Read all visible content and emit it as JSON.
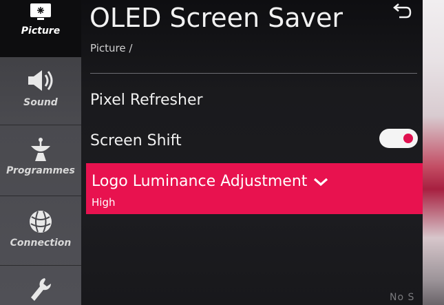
{
  "header": {
    "title": "OLED Screen Saver",
    "breadcrumb": "Picture /"
  },
  "sidebar": {
    "items": [
      {
        "label": "Picture",
        "icon": "picture-icon",
        "active": true
      },
      {
        "label": "Sound",
        "icon": "speaker-icon",
        "active": false
      },
      {
        "label": "Programmes",
        "icon": "satellite-dish-icon",
        "active": false
      },
      {
        "label": "Connection",
        "icon": "globe-icon",
        "active": false
      },
      {
        "label": "",
        "icon": "wrench-icon",
        "active": false
      }
    ]
  },
  "menu": {
    "pixel_refresher": "Pixel Refresher",
    "screen_shift": {
      "label": "Screen Shift",
      "state": "on"
    },
    "logo_luminance": {
      "label": "Logo Luminance Adjustment",
      "value": "High"
    }
  },
  "background_text": "No S",
  "colors": {
    "accent": "#e8124f",
    "toggle_knob": "#e0114f",
    "sidebar": "#48484d",
    "background": "#1a1a1d"
  }
}
